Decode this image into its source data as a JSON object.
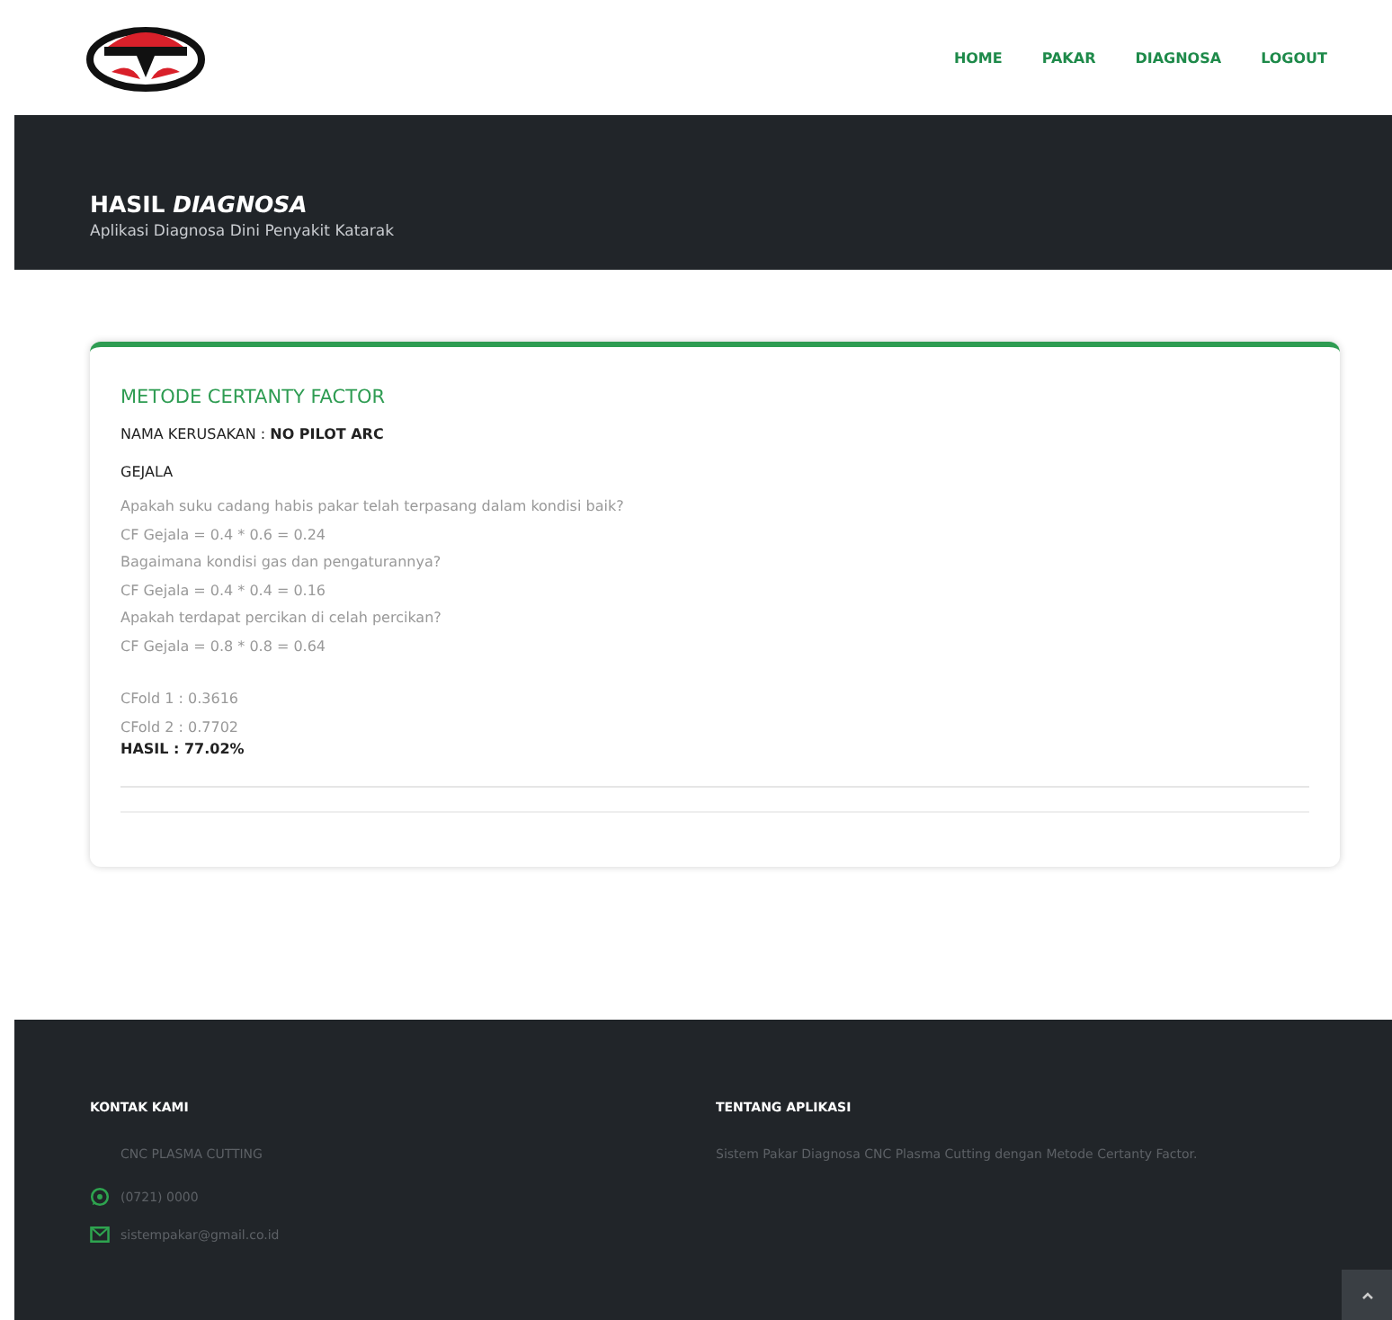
{
  "nav": [
    {
      "label": "HOME"
    },
    {
      "label": "PAKAR"
    },
    {
      "label": "DIAGNOSA"
    },
    {
      "label": "LOGOUT"
    }
  ],
  "banner": {
    "title": "HASIL *DIAGNOSA*",
    "subtitle": "Aplikasi Diagnosa Dini Penyakit Katarak"
  },
  "card": {
    "heading": "METODE CERTANTY FACTOR",
    "damage": "NAMA KERUSAKAN : **NO PILOT ARC**",
    "symptoms_heading": "GEJALA",
    "symptoms": [
      {
        "question": "Apakah suku cadang habis pakar telah terpasang dalam kondisi baik?",
        "cf": "CF Gejala = 0.4 * 0.6 = 0.24"
      },
      {
        "question": "Bagaimana kondisi gas dan pengaturannya?",
        "cf": "CF Gejala = 0.4 * 0.4 = 0.16"
      },
      {
        "question": "Apakah terdapat percikan di celah percikan?",
        "cf": "CF Gejala = 0.8 * 0.8 = 0.64"
      }
    ],
    "cfold": [
      "CFold 1 : 0.3616",
      "CFold 2 : 0.7702"
    ],
    "result": "HASIL : 77.02%"
  },
  "footer": {
    "contact_heading": "KONTAK KAMI",
    "company": "CNC PLASMA CUTTING",
    "contacts": [
      {
        "kind": "phone",
        "text": "(0721) 0000"
      },
      {
        "kind": "email",
        "text": "sistempakar@gmail.co.id"
      }
    ],
    "about_heading": "TENTANG APLIKASI",
    "about_text": "Sistem Pakar Diagnosa CNC Plasma Cutting dengan Metode Certanty Factor."
  }
}
